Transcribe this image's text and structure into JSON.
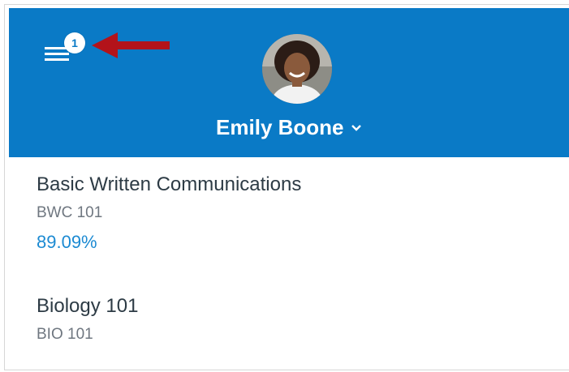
{
  "header": {
    "notification_count": "1",
    "user_name": "Emily Boone",
    "accent_color": "#0a7ac6",
    "menu_icon": "hamburger-menu-icon",
    "chevron_icon": "chevron-down-icon",
    "annotation_color": "#b3131a"
  },
  "courses": [
    {
      "title": "Basic Written Communications",
      "code": "BWC 101",
      "grade": "89.09%"
    },
    {
      "title": "Biology 101",
      "code": "BIO 101"
    }
  ]
}
